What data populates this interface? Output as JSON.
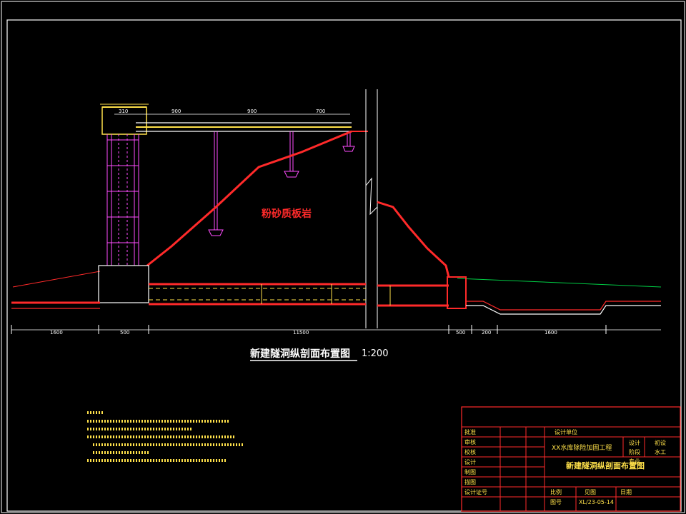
{
  "rock_label": "粉砂质板岩",
  "section_title": "新建隧洞纵剖面布置图",
  "section_scale": "1:200",
  "dims_top": [
    "310",
    "900",
    "900",
    "700"
  ],
  "dims_bottom": [
    "1600",
    "500",
    "11500",
    "500",
    "200",
    "1600"
  ],
  "titleblock": {
    "project": "XX水库除险加固工程",
    "drawing_title": "新建隧洞纵剖面布置图",
    "sheet_no": "XL/23-05-14",
    "unit_label": "设计单位",
    "scale_label": "比例",
    "scale_value": "见图",
    "sign_rows": [
      "批准",
      "审核",
      "校核",
      "设计",
      "制图",
      "描图",
      "设计证号"
    ],
    "right_labels": [
      "设计",
      "阶段",
      "初设",
      "专业",
      "水工"
    ],
    "bottom_labels": [
      "日期",
      "图号"
    ]
  },
  "colors": {
    "frame": "#ffffff",
    "structure": "#ff2a2a",
    "annotation": "#ffe14a",
    "tower": "#ff4dff",
    "ground": "#00cc44"
  }
}
